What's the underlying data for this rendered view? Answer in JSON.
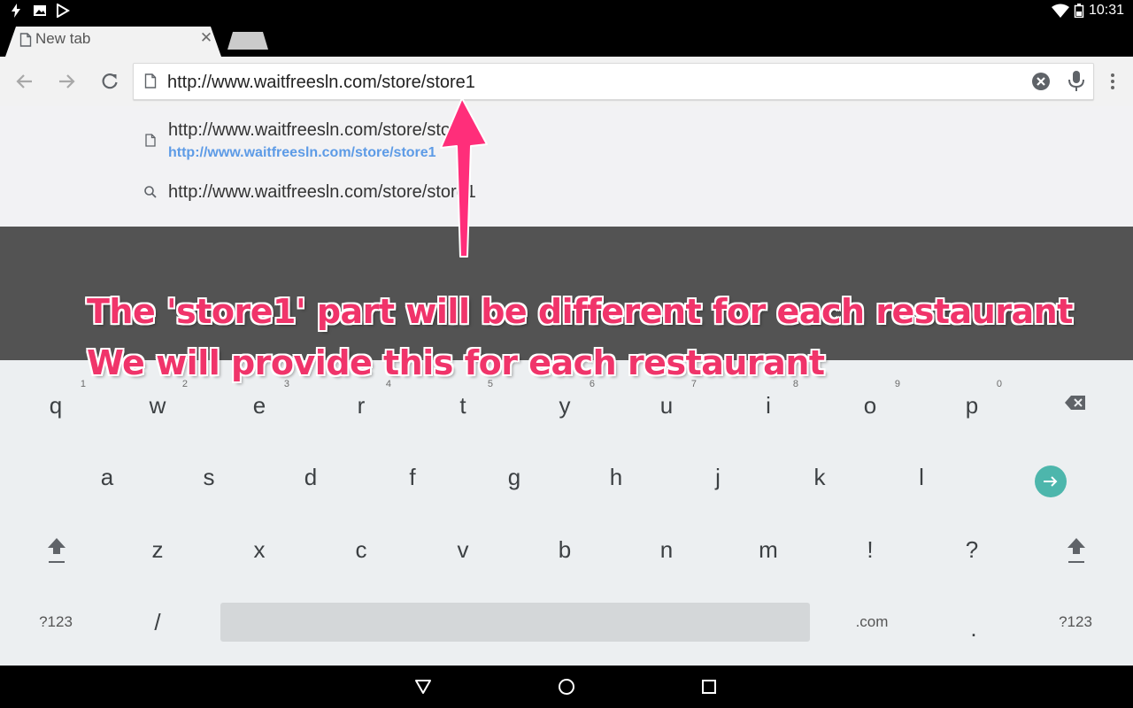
{
  "status_bar": {
    "time": "10:31",
    "icons": [
      "flash-icon",
      "image-icon",
      "play-store-icon",
      "wifi-icon",
      "battery-icon"
    ]
  },
  "tabs": [
    {
      "title": "New tab",
      "active": true
    }
  ],
  "toolbar": {
    "omnibox_value": "http://www.waitfreesln.com/store/store1",
    "icons": [
      "back-arrow-icon",
      "forward-arrow-icon",
      "reload-icon",
      "page-icon",
      "clear-icon",
      "microphone-icon",
      "overflow-menu-icon"
    ]
  },
  "suggestions": [
    {
      "title": "http://www.waitfreesln.com/store/store1",
      "url": "http://www.waitfreesln.com/store/store1",
      "icon": "page-icon"
    },
    {
      "title": "http://www.waitfreesln.com/store/store1",
      "icon": "search-icon"
    }
  ],
  "annotation": {
    "line1": "The 'store1' part will be different for each restaurant",
    "line2": "We will provide this for each restaurant",
    "color": "#f0346a"
  },
  "keyboard": {
    "row1": [
      "q",
      "w",
      "e",
      "r",
      "t",
      "y",
      "u",
      "i",
      "o",
      "p"
    ],
    "row1_hints": [
      "1",
      "2",
      "3",
      "4",
      "5",
      "6",
      "7",
      "8",
      "9",
      "0"
    ],
    "row2": [
      "a",
      "s",
      "d",
      "f",
      "g",
      "h",
      "j",
      "k",
      "l"
    ],
    "row3": [
      "z",
      "x",
      "c",
      "v",
      "b",
      "n",
      "m",
      "!",
      "?"
    ],
    "symbols_key": "?123",
    "slash_key": "/",
    "dotcom_key": ".com",
    "period_key": ".",
    "accent_color": "#4db6ac"
  },
  "nav": {
    "icons": [
      "back-triangle-icon",
      "home-circle-icon",
      "recents-square-icon"
    ]
  }
}
